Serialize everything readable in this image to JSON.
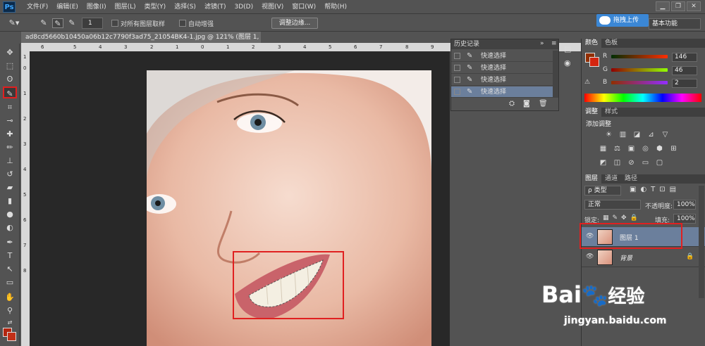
{
  "app": {
    "logo": "Ps"
  },
  "menu": [
    "文件(F)",
    "编辑(E)",
    "图像(I)",
    "图层(L)",
    "类型(Y)",
    "选择(S)",
    "滤镜(T)",
    "3D(D)",
    "视图(V)",
    "窗口(W)",
    "帮助(H)"
  ],
  "window_controls": [
    "▁",
    "❐",
    "✕"
  ],
  "options": {
    "brush_size": "1",
    "sample_all_layers": "对所有图层取样",
    "auto_enhance": "自动增强",
    "refine_edge": "调整边缘...",
    "upload": "拖拽上传",
    "workspace": "基本功能"
  },
  "document": {
    "tab": "ad8cd5660b10450a06b12c7790f3ad75_21054BK4-1.jpg @ 121% (图层 1, RGB/8#) *  ×"
  },
  "ruler": {
    "h_ticks": [
      "6",
      "5",
      "4",
      "3",
      "2",
      "1",
      "0",
      "1",
      "2",
      "3",
      "4",
      "5",
      "6",
      "7",
      "8",
      "9",
      "10",
      "11",
      "12",
      "13"
    ],
    "v_ticks": [
      "1",
      "0",
      "1",
      "2",
      "3",
      "4",
      "5",
      "6",
      "7",
      "8"
    ]
  },
  "history": {
    "title": "历史记录",
    "items": [
      {
        "label": "快速选择",
        "selected": false
      },
      {
        "label": "快速选择",
        "selected": false
      },
      {
        "label": "快速选择",
        "selected": false
      },
      {
        "label": "快速选择",
        "selected": true
      }
    ]
  },
  "color_panel": {
    "tabs": [
      "颜色",
      "色板"
    ],
    "r_label": "R",
    "g_label": "G",
    "b_label": "B",
    "r": "146",
    "g": "46",
    "b": "2",
    "fg_color": "#922e02"
  },
  "adjust_panel": {
    "tabs": [
      "调整",
      "样式"
    ],
    "heading": "添加调整",
    "icons_row1": [
      "☀",
      "▥",
      "◪",
      "⊿",
      "▽"
    ],
    "icons_row2": [
      "▦",
      "⚖",
      "▣",
      "◎",
      "⬢",
      "⊞"
    ],
    "icons_row3": [
      "◩",
      "◫",
      "⊘",
      "▭",
      "▢"
    ]
  },
  "layers_panel": {
    "tabs": [
      "图层",
      "通道",
      "路径"
    ],
    "filter": "ρ 类型",
    "blend_mode": "正常",
    "opacity_label": "不透明度:",
    "opacity": "100%",
    "lock_label": "锁定:",
    "fill_label": "填充:",
    "fill": "100%",
    "layers": [
      {
        "name": "图层 1",
        "selected": true
      },
      {
        "name": "背景",
        "selected": false
      }
    ]
  },
  "watermark": {
    "brand_a": "Bai",
    "brand_b": "经验",
    "url": "jingyan.baidu.com"
  },
  "accent": "#e02020"
}
